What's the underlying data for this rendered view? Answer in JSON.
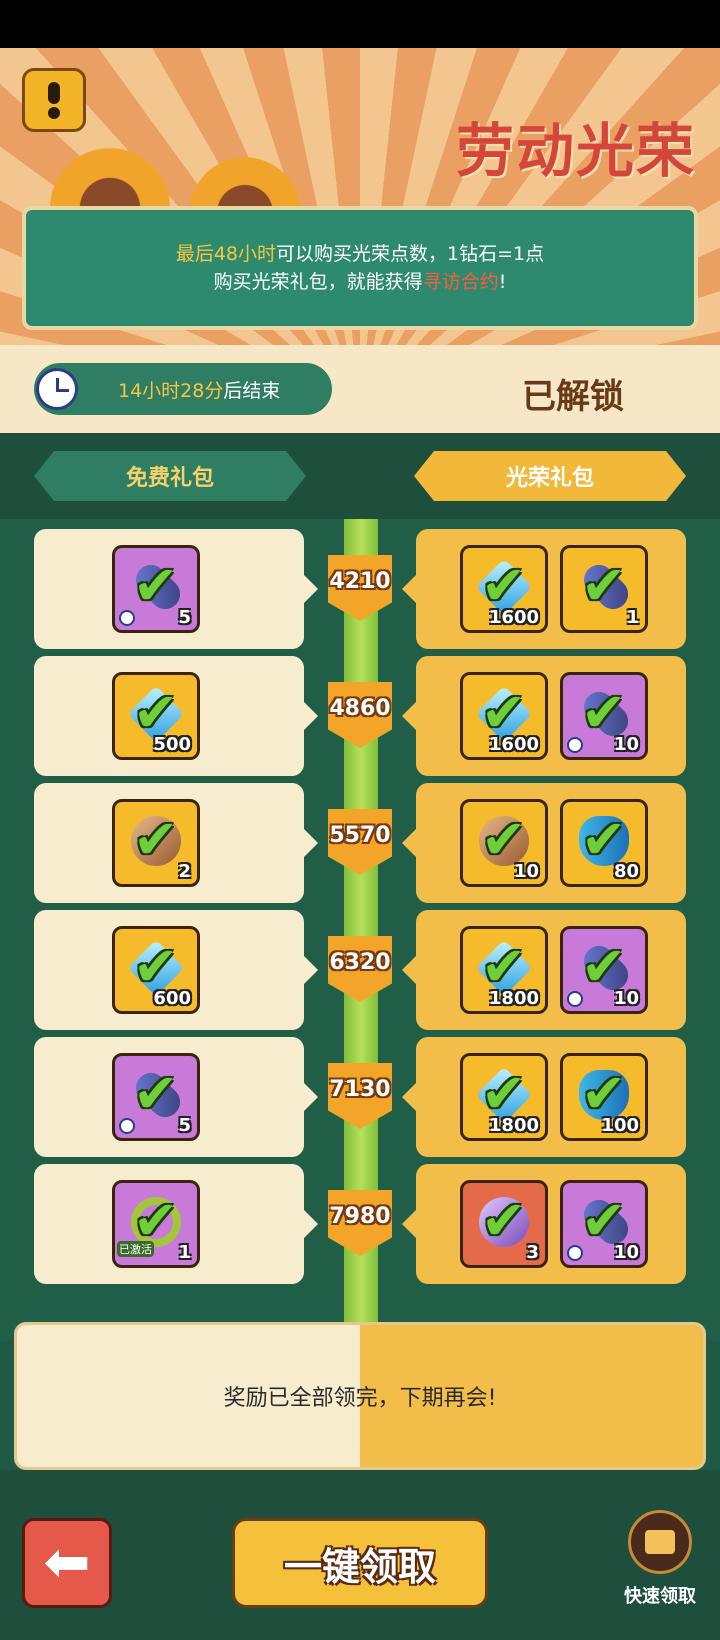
{
  "banner": {
    "title": "劳动光荣"
  },
  "notice": {
    "line1_a": "最后48小时",
    "line1_b": "可以购买光荣点数，1钻石=1点",
    "line2_a": "购买光荣礼包，就能获得",
    "line2_b": "寻访合约",
    "line2_c": "!"
  },
  "timer": {
    "time": "14小时28分",
    "suffix": "后结束"
  },
  "status": {
    "label": "已解锁"
  },
  "tabs": {
    "free": "免费礼包",
    "glory": "光荣礼包"
  },
  "rows": [
    {
      "points": "4210",
      "free": {
        "icon": "pen",
        "count": "5",
        "color": "purple"
      },
      "glory": [
        {
          "icon": "diamond",
          "count": "1600",
          "color": "yellow"
        },
        {
          "icon": "pen",
          "count": "1",
          "color": "yellow"
        }
      ]
    },
    {
      "points": "4860",
      "free": {
        "icon": "diamond",
        "count": "500",
        "color": "yellow"
      },
      "glory": [
        {
          "icon": "diamond",
          "count": "1600",
          "color": "yellow"
        },
        {
          "icon": "pen",
          "count": "10",
          "color": "purple"
        }
      ]
    },
    {
      "points": "5570",
      "free": {
        "icon": "scroll",
        "count": "2",
        "color": "yellow"
      },
      "glory": [
        {
          "icon": "scroll",
          "count": "10",
          "color": "yellow"
        },
        {
          "icon": "butterfly",
          "count": "80",
          "color": "yellow"
        }
      ]
    },
    {
      "points": "6320",
      "free": {
        "icon": "diamond",
        "count": "600",
        "color": "yellow"
      },
      "glory": [
        {
          "icon": "diamond",
          "count": "1800",
          "color": "yellow"
        },
        {
          "icon": "pen",
          "count": "10",
          "color": "purple"
        }
      ]
    },
    {
      "points": "7130",
      "free": {
        "icon": "pen",
        "count": "5",
        "color": "purple"
      },
      "glory": [
        {
          "icon": "diamond",
          "count": "1800",
          "color": "yellow"
        },
        {
          "icon": "butterfly",
          "count": "100",
          "color": "yellow"
        }
      ]
    },
    {
      "points": "7980",
      "free": {
        "icon": "ring",
        "count": "1",
        "color": "purple",
        "tag": "已激活"
      },
      "glory": [
        {
          "icon": "potion",
          "count": "3",
          "color": "red"
        },
        {
          "icon": "pen",
          "count": "10",
          "color": "purple"
        }
      ]
    }
  ],
  "footer": {
    "message": "奖励已全部领完，下期再会!"
  },
  "buttons": {
    "claim_all": "一键领取",
    "quick_claim": "快速领取"
  },
  "colors": {
    "accent_green": "#2e8a6e",
    "accent_gold": "#f3bd4a",
    "highlight_red": "#ff5a3a"
  }
}
